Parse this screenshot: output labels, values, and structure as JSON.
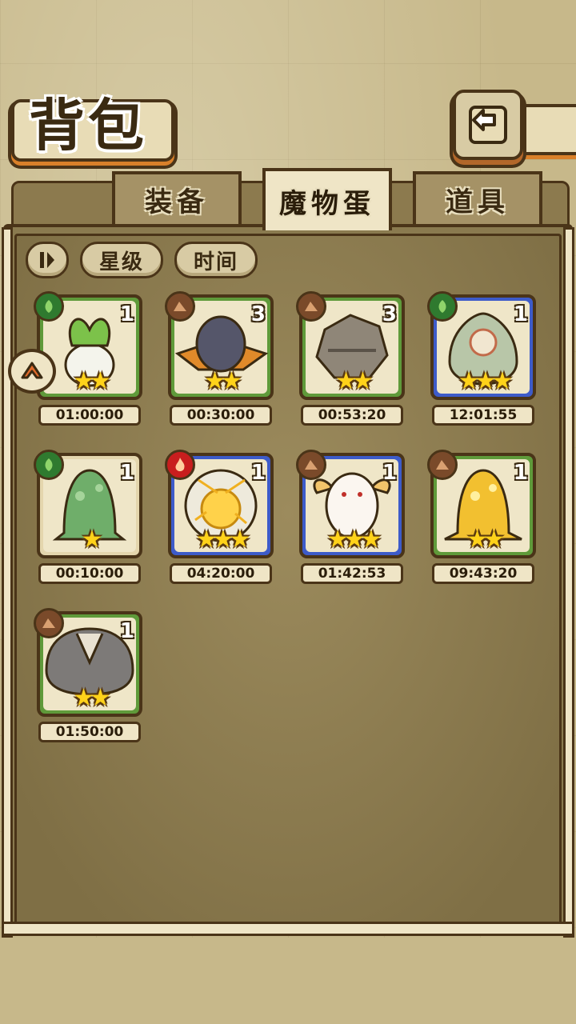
{
  "header": {
    "title": "背包"
  },
  "tabs": [
    {
      "label": "装备"
    },
    {
      "label": "魔物蛋"
    },
    {
      "label": "道具"
    }
  ],
  "sort": {
    "star_label": "星级",
    "time_label": "时间"
  },
  "eggs": [
    {
      "name": "radish",
      "element": "nature",
      "count": "1",
      "stars": "★★",
      "timer": "01:00:00",
      "frame": "green"
    },
    {
      "name": "dark-egg-hat",
      "element": "earth",
      "count": "3",
      "stars": "★★",
      "timer": "00:30:00",
      "frame": "green"
    },
    {
      "name": "rock-golem",
      "element": "earth",
      "count": "3",
      "stars": "★★",
      "timer": "00:53:20",
      "frame": "green"
    },
    {
      "name": "seed-pod",
      "element": "nature",
      "count": "1",
      "stars": "★★★",
      "timer": "12:01:55",
      "frame": "blue"
    },
    {
      "name": "green-slime",
      "element": "nature",
      "count": "1",
      "stars": "★",
      "timer": "00:10:00",
      "frame": "tan"
    },
    {
      "name": "thunder-egg",
      "element": "fire",
      "count": "1",
      "stars": "★★★",
      "timer": "04:20:00",
      "frame": "blue"
    },
    {
      "name": "fluffy-fairy",
      "element": "earth",
      "count": "1",
      "stars": "★★★",
      "timer": "01:42:53",
      "frame": "blue"
    },
    {
      "name": "golden-slime",
      "element": "earth",
      "count": "1",
      "stars": "★★",
      "timer": "09:43:20",
      "frame": "green"
    },
    {
      "name": "gray-shell",
      "element": "earth",
      "count": "1",
      "stars": "★★",
      "timer": "01:50:00",
      "frame": "green"
    }
  ],
  "colors": {
    "nature": "#2f7a2f",
    "earth": "#7a4a2a",
    "fire": "#c81e1e",
    "star": "#ffd21a"
  }
}
